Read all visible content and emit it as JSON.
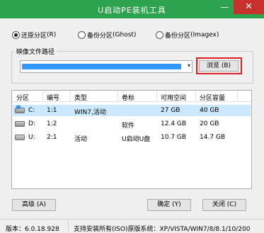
{
  "window": {
    "title": "U启动PE装机工具",
    "minimize_glyph": "—",
    "close_glyph": "✕",
    "accent": "#2ea34f",
    "close_color": "#c7302b"
  },
  "mode_options": [
    {
      "label": "还原分区",
      "key": "(R)",
      "checked": true
    },
    {
      "label": "备份分区",
      "key": "(Ghost)",
      "checked": false
    },
    {
      "label": "备份分区",
      "key": "(Imagex)",
      "checked": false
    }
  ],
  "image_path": {
    "label": "映像文件路径",
    "browse_label": "浏览 (B)"
  },
  "table": {
    "headers": [
      "分区",
      "编号",
      "类型",
      "卷标",
      "可用空间",
      "分区容量"
    ],
    "rows": [
      {
        "partition": "C:",
        "number": "1:1",
        "type": "WIN7,活动",
        "label": "",
        "free": "27 GB",
        "capacity": "40 GB",
        "icon": "windows-disk-icon",
        "selected": true
      },
      {
        "partition": "D:",
        "number": "1:2",
        "type": "",
        "label": "软件",
        "free": "12.4 GB",
        "capacity": "20 GB",
        "icon": "disk-icon",
        "selected": false
      },
      {
        "partition": "U:",
        "number": "2:1",
        "type": "活动",
        "label": "U启动U盘",
        "free": "10.7 GB",
        "capacity": "14.7 GB",
        "icon": "usb-disk-icon",
        "selected": false
      }
    ]
  },
  "buttons": {
    "advanced": "高级 (A)",
    "ok": "确定 (Y)",
    "close": "关闭 (C)"
  },
  "footer": {
    "version": "版本：6.0.18.928",
    "support": "支持安装所有(ISO)原版系统：XP/VISTA/WIN7/8/8.1/10/200"
  }
}
